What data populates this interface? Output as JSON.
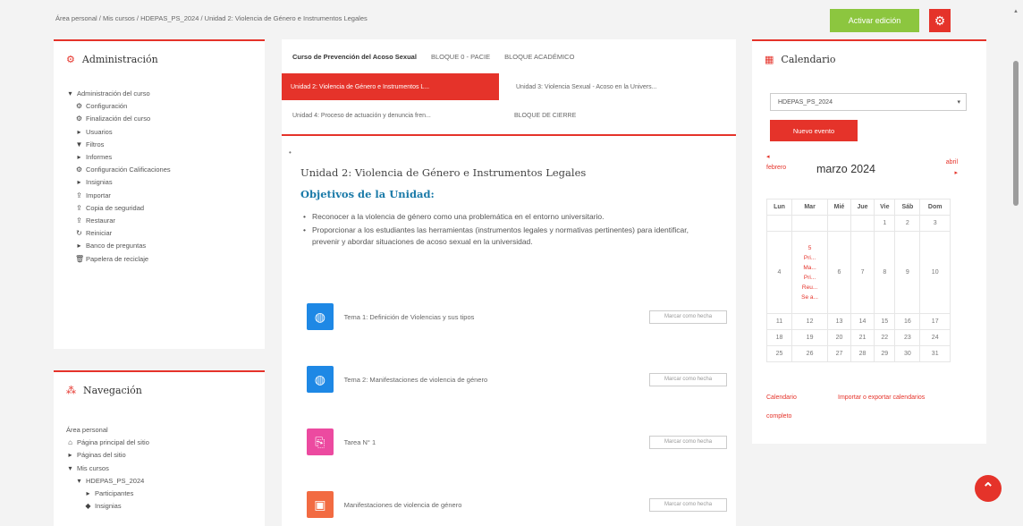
{
  "breadcrumb": [
    "Área personal",
    "Mis cursos",
    "HDEPAS_PS_2024",
    "Unidad 2: Violencia de Género e Instrumentos Legales"
  ],
  "breadcrumb_sep": "/",
  "header": {
    "edit_button": "Activar edición",
    "gear_icon": "gear-icon"
  },
  "admin_block": {
    "title": "Administración",
    "items": [
      {
        "label": "Administración del curso",
        "icon": "caret-down",
        "level": 0
      },
      {
        "label": "Configuración",
        "icon": "gear",
        "level": 1
      },
      {
        "label": "Finalización del curso",
        "icon": "gear",
        "level": 1
      },
      {
        "label": "Usuarios",
        "icon": "caret-right",
        "level": 1
      },
      {
        "label": "Filtros",
        "icon": "filter",
        "level": 1
      },
      {
        "label": "Informes",
        "icon": "caret-right",
        "level": 1
      },
      {
        "label": "Configuración Calificaciones",
        "icon": "gear",
        "level": 1
      },
      {
        "label": "Insignias",
        "icon": "caret-right",
        "level": 1
      },
      {
        "label": "Importar",
        "icon": "upload",
        "level": 1
      },
      {
        "label": "Copia de seguridad",
        "icon": "upload",
        "level": 1
      },
      {
        "label": "Restaurar",
        "icon": "upload",
        "level": 1
      },
      {
        "label": "Reiniciar",
        "icon": "reset",
        "level": 1
      },
      {
        "label": "Banco de preguntas",
        "icon": "caret-right",
        "level": 1
      },
      {
        "label": "Papelera de reciclaje",
        "icon": "trash",
        "level": 1
      }
    ]
  },
  "nav_block": {
    "title": "Navegación",
    "items": [
      {
        "label": "Área personal",
        "icon": "",
        "level": 0
      },
      {
        "label": "Página principal del sitio",
        "icon": "home",
        "level": 0
      },
      {
        "label": "Páginas del sitio",
        "icon": "caret-right",
        "level": 0
      },
      {
        "label": "Mis cursos",
        "icon": "caret-down",
        "level": 0
      },
      {
        "label": "HDEPAS_PS_2024",
        "icon": "caret-down",
        "level": 1
      },
      {
        "label": "Participantes",
        "icon": "caret-right",
        "level": 2
      },
      {
        "label": "Insignias",
        "icon": "badge",
        "level": 2
      }
    ]
  },
  "tabs": {
    "row1": [
      "Curso de Prevención del Acoso Sexual",
      "BLOQUE 0 - PACIE",
      "BLOQUE ACADÉMICO"
    ],
    "unit2": "Unidad 2: Violencia de Género e Instrumentos L...",
    "unit3": "Unidad 3: Violencia Sexual - Acoso en la Univers...",
    "unit4": "Unidad 4: Proceso de actuación y denuncia fren...",
    "cierre": "BLOQUE DE CIERRE"
  },
  "content": {
    "title": "Unidad 2: Violencia de Género e Instrumentos Legales",
    "objectives_title": "Objetivos de la Unidad:",
    "objectives": [
      "Reconocer a la violencia de género como una problemática en el entorno universitario.",
      "Proporcionar a los estudiantes las herramientas (instrumentos legales y normativas pertinentes) para identificar, prevenir y abordar situaciones de acoso sexual en la universidad."
    ],
    "activities": [
      {
        "label": "Tema 1: Definición de Violencias y sus tipos",
        "icon": "globe-icon",
        "color": "#1e88e5",
        "button": "Marcar como hecha"
      },
      {
        "label": "Tema 2: Manifestaciones de violencia de género",
        "icon": "globe-icon",
        "color": "#1e88e5",
        "button": "Marcar como hecha"
      },
      {
        "label": "Tarea N° 1",
        "icon": "assignment-icon",
        "color": "#ec4aa0",
        "button": "Marcar como hecha"
      },
      {
        "label": "Manifestaciones de violencia de género",
        "icon": "forum-icon",
        "color": "#f26b42",
        "button": "Marcar como hecha"
      }
    ]
  },
  "calendar": {
    "title": "Calendario",
    "course_select": "HDEPAS_PS_2024",
    "new_event": "Nuevo evento",
    "prev_month": "febrero",
    "next_month": "abril",
    "month_label": "marzo 2024",
    "weekdays": [
      "Lun",
      "Mar",
      "Mié",
      "Jue",
      "Vie",
      "Sáb",
      "Dom"
    ],
    "weeks": [
      [
        "",
        "",
        "",
        "",
        "1",
        "2",
        "3"
      ],
      [
        "4",
        "5",
        "6",
        "7",
        "8",
        "9",
        "10"
      ],
      [
        "11",
        "12",
        "13",
        "14",
        "15",
        "16",
        "17"
      ],
      [
        "18",
        "19",
        "20",
        "21",
        "22",
        "23",
        "24"
      ],
      [
        "25",
        "26",
        "27",
        "28",
        "29",
        "30",
        "31"
      ]
    ],
    "event_day": "5",
    "events": [
      "Pri...",
      "Ma...",
      "Pri...",
      "Reu...",
      "Se a..."
    ],
    "link_full": "Calendario completo",
    "link_export": "Importar o exportar calendarios"
  },
  "colors": {
    "accent": "#e5332a",
    "edit_green": "#8cc63f",
    "objectives_blue": "#1a7aa8"
  }
}
